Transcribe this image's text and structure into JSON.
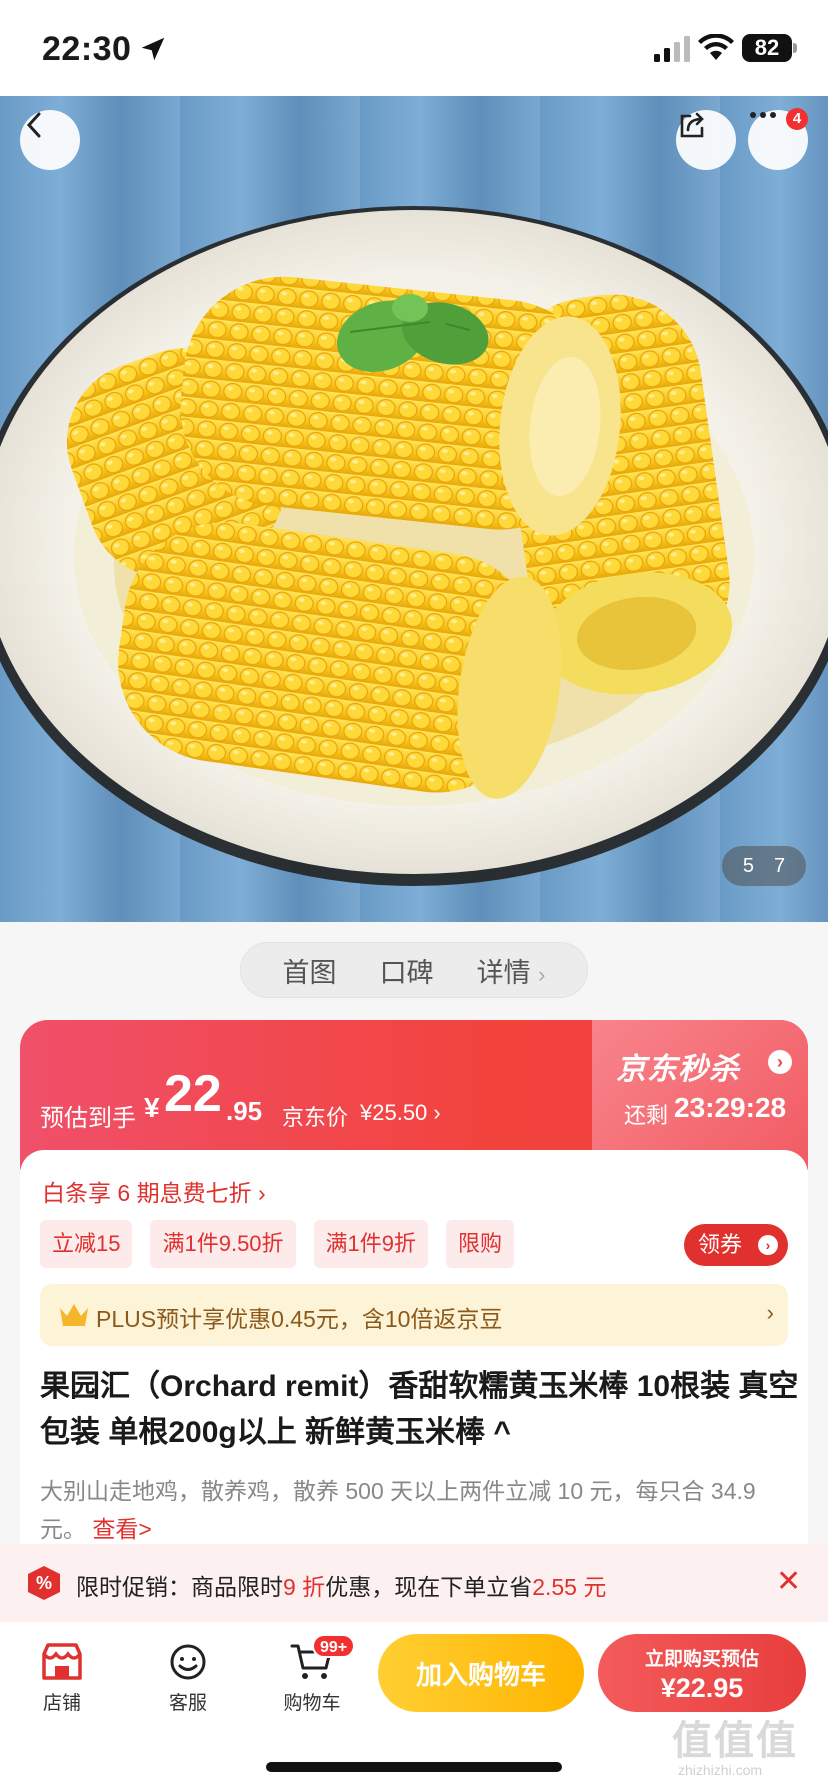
{
  "status_bar": {
    "time": "22:30",
    "battery": "82"
  },
  "gallery": {
    "current": "5",
    "total": "7",
    "more_badge": "4"
  },
  "tabs": [
    {
      "label": "首图"
    },
    {
      "label": "口碑"
    },
    {
      "label": "详情"
    }
  ],
  "tabs_chevron": "›",
  "price": {
    "estimate_label": "预估到手",
    "currency": "¥",
    "integer": "22",
    "decimal": ".95",
    "jd_label": "京东价",
    "jd_price": "¥25.50 ›",
    "seckill": "京东秒杀",
    "remain_label": "还剩",
    "countdown": "23:29:28"
  },
  "baitiao": "白条享 6 期息费七折 ›",
  "chips": [
    {
      "label": "立减15"
    },
    {
      "label": "满1件9.50折"
    },
    {
      "label": "满1件9折"
    },
    {
      "label": "限购"
    }
  ],
  "coupon_label": "领券",
  "plus": {
    "text": "PLUS预计享优惠0.45元，含10倍返京豆",
    "arrow": "›"
  },
  "product": {
    "title": "果园汇（Orchard remit）香甜软糯黄玉米棒 10根装 真空包装 单根200g以上 新鲜黄玉米棒 ^",
    "desc": "大别山走地鸡，散养鸡，散养 500 天以上两件立减 10 元，每只合 34.9元。",
    "desc_link": "查看>"
  },
  "promo": {
    "prefix": "限时促销：商品限时",
    "discount": "9 折",
    "middle": "优惠，现在下单立省",
    "saving": "2.55 元",
    "close": "✕"
  },
  "bottom": {
    "shop": "店铺",
    "service": "客服",
    "cart": "购物车",
    "cart_badge": "99+",
    "add_cart": "加入购物车",
    "buy_line1": "立即购买预估",
    "buy_line2": "¥22.95"
  },
  "watermark": {
    "main": "值值值",
    "sub": "zhizhizhi.com"
  },
  "colors": {
    "accent_red": "#e0312e",
    "seckill_red": "#f2433d",
    "add_cart_yellow": "#ffbe1a",
    "plus_gold": "#8b5a1b"
  }
}
